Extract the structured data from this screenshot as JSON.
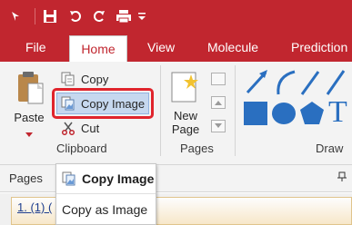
{
  "qat": {
    "icons": [
      "app-menu-icon",
      "save-icon",
      "undo-icon",
      "redo-icon",
      "print-icon",
      "customize-icon"
    ]
  },
  "tabs": [
    {
      "label": "File"
    },
    {
      "label": "Home",
      "active": true
    },
    {
      "label": "View"
    },
    {
      "label": "Molecule"
    },
    {
      "label": "Prediction"
    }
  ],
  "clipboard": {
    "paste_label": "Paste",
    "copy_label": "Copy",
    "copy_image_label": "Copy Image",
    "cut_label": "Cut",
    "group_label": "Clipboard"
  },
  "pages": {
    "new_page_line1": "New",
    "new_page_line2": "Page",
    "group_label": "Pages"
  },
  "draw": {
    "group_label": "Draw",
    "text_tool_glyph": "T"
  },
  "pages_bar": {
    "label": "Pages",
    "doc_label": "1. (1) ("
  },
  "menu": {
    "header": "Copy Image",
    "items": [
      "Copy as Image"
    ]
  },
  "colors": {
    "accent": "#c1262f",
    "highlight": "#e0242c",
    "shape_blue": "#2a6fc0"
  }
}
